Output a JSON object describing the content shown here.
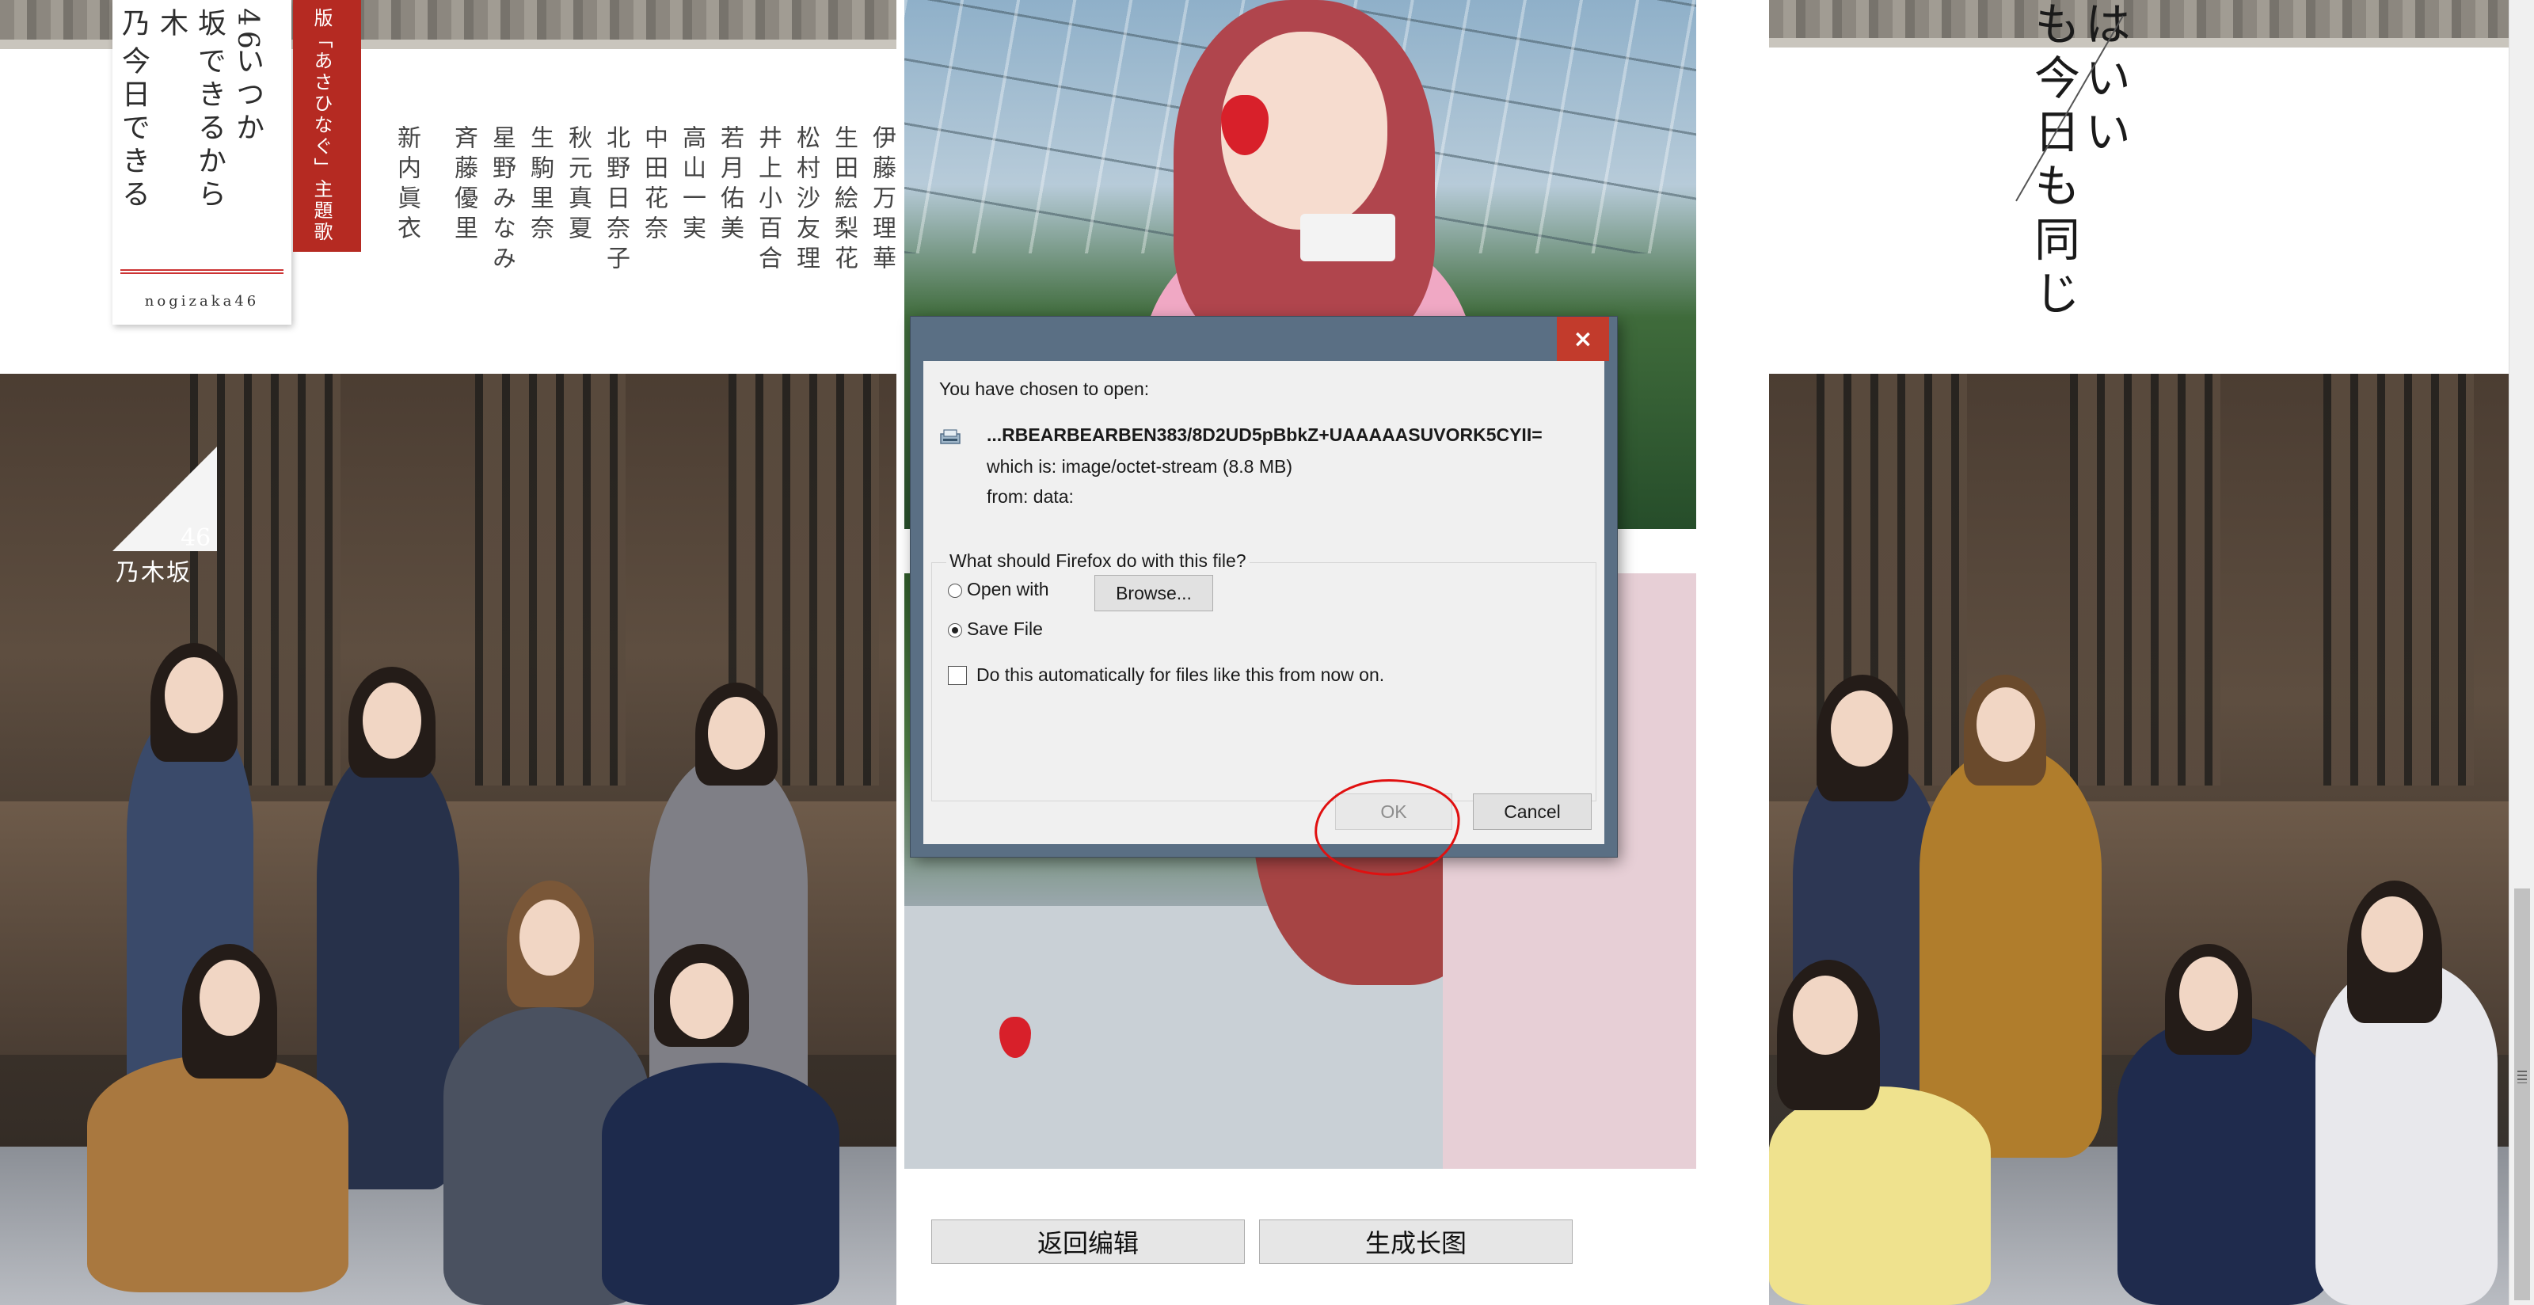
{
  "poster_left": {
    "card_columns": [
      "46",
      "いつか",
      "坂",
      "できるから",
      "木",
      "乃",
      "今",
      "日",
      "できる"
    ],
    "card_col_46": "46",
    "card_col_itsuka": "いつか",
    "card_col_saka": "坂",
    "card_col_dekirukara": "できるから",
    "card_col_ki": "木",
    "card_col_no": "乃",
    "card_col_kyou": "今日できる",
    "card_footer": "nogizaka46",
    "red_tag": "版「あさひなぐ」主題歌",
    "members": [
      "伊藤万理華",
      "生田絵梨花",
      "松村沙友理",
      "井上小百合",
      "若月佑美",
      "高山一実",
      "中田花奈",
      "北野日奈子",
      "秋元真夏",
      "生駒里奈",
      "星野みなみ",
      "斉藤優里",
      "新内眞衣"
    ],
    "logo_46": "46",
    "logo_text": "乃木坂"
  },
  "poster_right": {
    "vertical_text_1": "はいい",
    "vertical_text_2": "も今日も同じ"
  },
  "dialog": {
    "close_glyph": "×",
    "chosen_label": "You have chosen to open:",
    "file_name": "...RBEARBEARBEN383/8D2UD5pBbkZ+UAAAAASUVORK5CYII=",
    "which_is": "which is:  image/octet-stream (8.8 MB)",
    "from": "from:  data:",
    "question": "What should Firefox do with this file?",
    "open_with_label": "Open with",
    "browse_label": "Browse...",
    "save_file_label": "Save File",
    "selected_option": "Save File",
    "auto_label": "Do this automatically for files like this from now on.",
    "auto_checked": false,
    "ok_label": "OK",
    "cancel_label": "Cancel"
  },
  "page_buttons": {
    "back_label": "返回编辑",
    "generate_label": "生成长图"
  },
  "icons": [
    "file-download-icon",
    "close-icon",
    "scroll-grip-icon"
  ],
  "colors": {
    "dialog_title_bar": "#5a6f84",
    "close_button": "#c23b2c",
    "poster_red": "#b52a22",
    "annotation_circle": "#e01010"
  }
}
